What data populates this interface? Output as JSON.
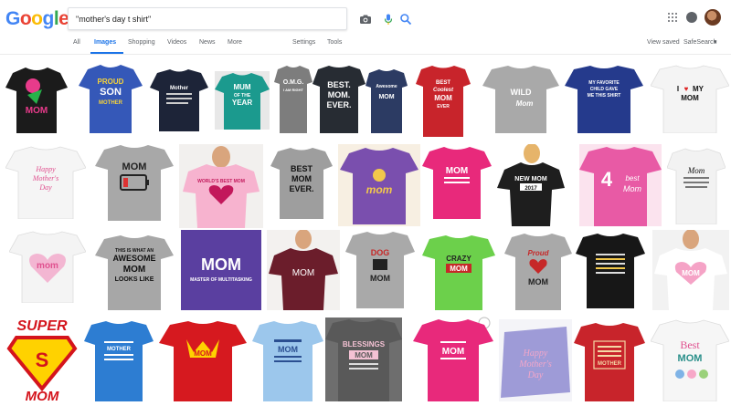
{
  "logo": {
    "g1": "G",
    "o1": "o",
    "o2": "o",
    "g2": "g",
    "l": "l",
    "e": "e"
  },
  "search": {
    "query": "\"mother's day t shirt\""
  },
  "nav": {
    "tabs": [
      "All",
      "Images",
      "Shopping",
      "Videos",
      "News",
      "More"
    ],
    "settings": "Settings",
    "tools": "Tools",
    "view_saved": "View saved",
    "safesearch": "SafeSearch"
  },
  "icons": [
    "camera-icon",
    "mic-icon",
    "search-icon",
    "apps-icon",
    "bell-icon",
    "avatar"
  ],
  "shirts": {
    "r1_1": [
      "MOM"
    ],
    "r1_2": [
      "PROUD",
      "SON",
      "MOTHER"
    ],
    "r1_3": [
      "Mother"
    ],
    "r1_4": [
      "MUM",
      "OF THE",
      "YEAR"
    ],
    "r1_5": [
      "O.M.G.",
      "I AM RIGHT"
    ],
    "r1_6": [
      "BEST.",
      "MOM.",
      "EVER."
    ],
    "r1_7": [
      "Awesome",
      "MOM"
    ],
    "r1_8": [
      "BEST",
      "Coolest",
      "MOM",
      "EVER"
    ],
    "r1_9": [
      "WILD",
      "Mom"
    ],
    "r1_10": [
      "MY FAVORITE",
      "CHILD GAVE",
      "ME THIS SHIRT"
    ],
    "r1_11": [
      "I",
      "MY",
      "MOM"
    ],
    "r2_1": [
      "Happy",
      "Mother's",
      "Day"
    ],
    "r2_2": [
      "MOM"
    ],
    "r2_3": [
      "WORLD'S BEST MOM"
    ],
    "r2_4": [
      "BEST",
      "MOM",
      "EVER."
    ],
    "r2_5": [
      "mom"
    ],
    "r2_6": [
      "MOM"
    ],
    "r2_7": [
      "NEW MOM",
      "2017"
    ],
    "r2_8": [
      "4",
      "best",
      "Mom"
    ],
    "r2_9": [
      "Mom"
    ],
    "r3_1": [
      "mom"
    ],
    "r3_2": [
      "THIS IS WHAT AN",
      "AWESOME",
      "MOM",
      "LOOKS LIKE"
    ],
    "r3_3": [
      "MOM",
      "MASTER OF MULTITASKING"
    ],
    "r3_4": [
      "MOM"
    ],
    "r3_5": [
      "DOG",
      "MOM"
    ],
    "r3_6": [
      "CRAZY",
      "MOM"
    ],
    "r3_7": [
      "Proud",
      "MOM"
    ],
    "r3_9": [
      "MOM"
    ],
    "r4_1": [
      "SUPER",
      "S",
      "MOM"
    ],
    "r4_2": [
      "MOTHER"
    ],
    "r4_3": [
      "MOM"
    ],
    "r4_4": [
      "MOM"
    ],
    "r4_5": [
      "BLESSINGS",
      "MOM"
    ],
    "r4_6": [
      "MOM"
    ],
    "r4_7": [
      "Happy",
      "Mother's",
      "Day"
    ],
    "r4_8": [
      "MOTHER"
    ],
    "r4_9": [
      "Best",
      "MOM"
    ]
  }
}
